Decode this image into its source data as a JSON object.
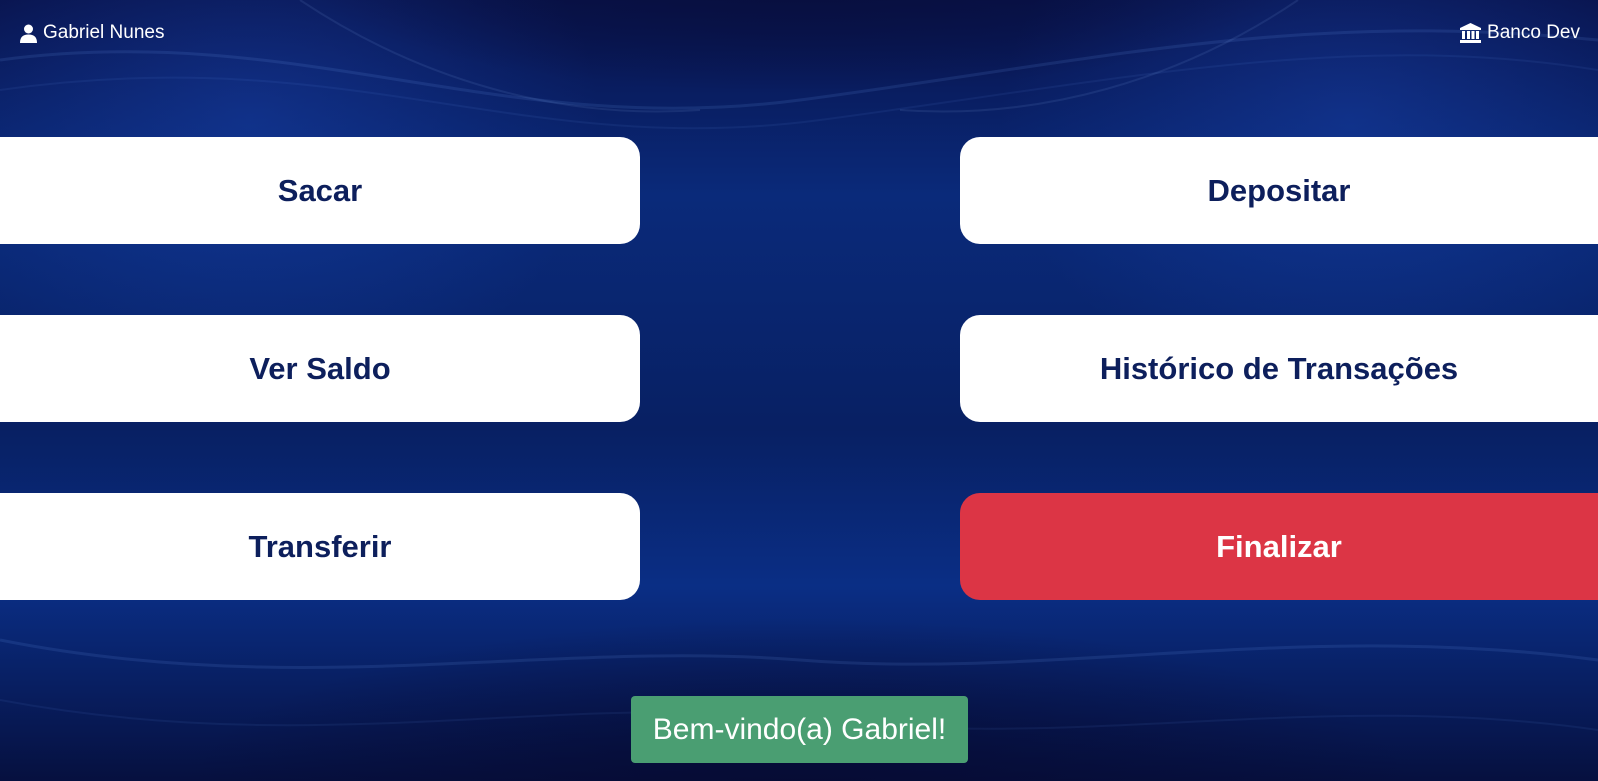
{
  "header": {
    "user_name": "Gabriel Nunes",
    "user_icon": "user-icon",
    "bank_name": "Banco Dev",
    "bank_icon": "bank-icon"
  },
  "menu": {
    "withdraw_label": "Sacar",
    "deposit_label": "Depositar",
    "balance_label": "Ver Saldo",
    "history_label": "Histórico de Transações",
    "transfer_label": "Transferir",
    "finish_label": "Finalizar"
  },
  "toast": {
    "message": "Bem-vindo(a) Gabriel!"
  },
  "colors": {
    "button_bg": "#ffffff",
    "button_text": "#0d1f5c",
    "finish_bg": "#dc3545",
    "toast_bg": "#4a9e72",
    "background": "#0a2a7a"
  }
}
